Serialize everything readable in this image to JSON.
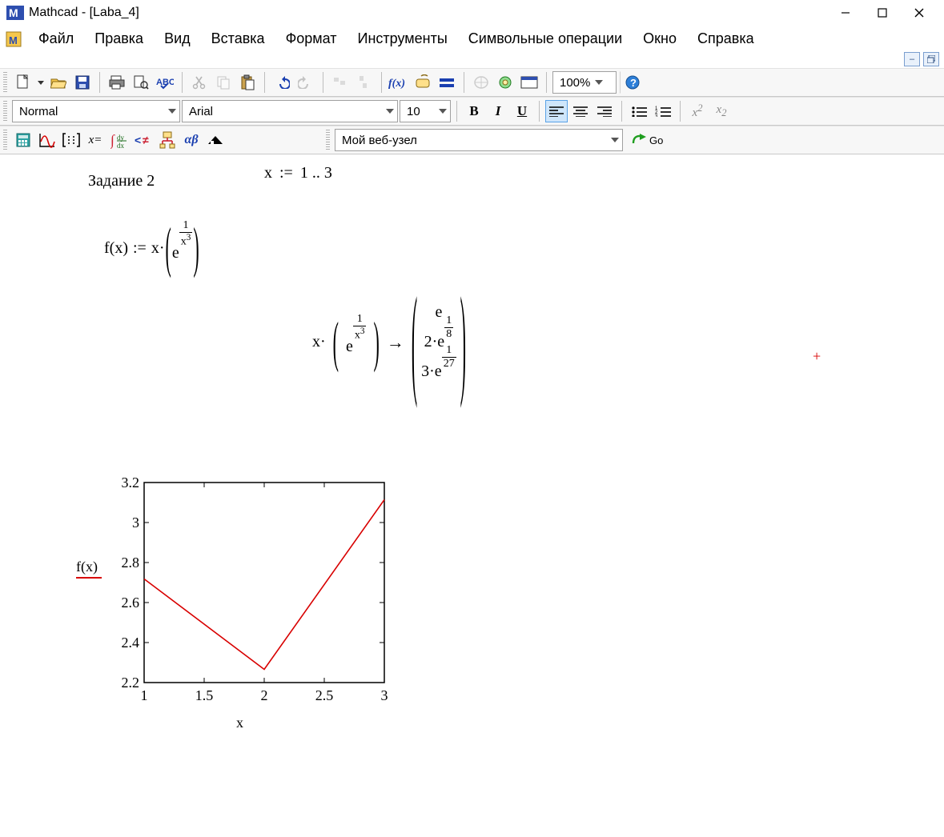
{
  "title": "Mathcad - [Laba_4]",
  "menu": [
    "Файл",
    "Правка",
    "Вид",
    "Вставка",
    "Формат",
    "Инструменты",
    "Символьные операции",
    "Окно",
    "Справка"
  ],
  "toolbar1": {
    "zoom": "100%"
  },
  "toolbar2": {
    "style": "Normal",
    "font": "Arial",
    "size": "10"
  },
  "toolbar3": {
    "web": "Мой веб-узел",
    "go": "Go"
  },
  "worksheet": {
    "task_label": "Задание 2",
    "range_def": {
      "lhs": "x",
      "op": ":=",
      "rhs": "1 .. 3"
    },
    "fdef_lhs": "f(x)",
    "fdef_op": ":=",
    "sym_eval_arrow": "→",
    "vector_result": [
      "e",
      [
        "2·e",
        "1",
        "8"
      ],
      [
        "3·e",
        "1",
        "27"
      ]
    ]
  },
  "chart_data": {
    "type": "line",
    "title": "",
    "xlabel": "x",
    "ylabel": "",
    "legend": [
      "f(x)"
    ],
    "x": [
      1,
      2,
      3
    ],
    "y": [
      2.718,
      2.266,
      3.114
    ],
    "xlim": [
      1,
      3
    ],
    "ylim": [
      2.2,
      3.2
    ],
    "xticks": [
      1,
      1.5,
      2,
      2.5,
      3
    ],
    "yticks": [
      2.2,
      2.4,
      2.6,
      2.8,
      3,
      3.2
    ],
    "series_color": "#d80000"
  }
}
